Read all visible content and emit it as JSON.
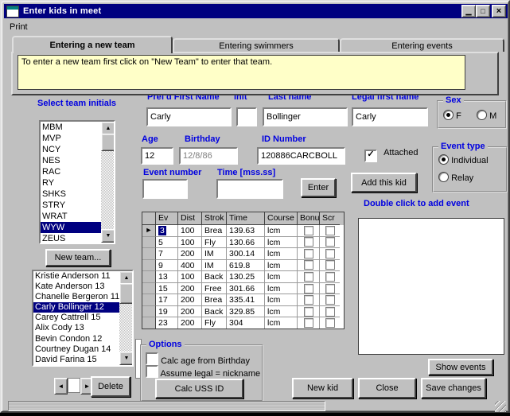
{
  "window": {
    "title": "Enter kids in meet",
    "controls": {
      "minimize": "▁",
      "maximize": "□",
      "close": "×"
    }
  },
  "menu": {
    "print": "Print"
  },
  "tabs": [
    {
      "label": "Entering a new team"
    },
    {
      "label": "Entering swimmers"
    },
    {
      "label": "Entering events"
    }
  ],
  "info_box": "To enter a new team first click on \"New Team\" to enter that team.",
  "team_panel": {
    "label": "Select team initials",
    "teams": [
      "MBM",
      "MVP",
      "NCY",
      "NES",
      "RAC",
      "RY",
      "SHKS",
      "STRY",
      "WRAT",
      "WYW",
      "ZEUS"
    ],
    "selected": "WYW",
    "new_team_button": "New team..."
  },
  "swimmer_panel": {
    "swimmers": [
      "Kristie Anderson 11",
      "Kate Anderson 13",
      "Chanelle Bergeron 11",
      "Carly Bollinger 12",
      "Carey Cattrell 15",
      "Alix Cody 13",
      "Bevin Condon 12",
      "Courtney Dugan 14",
      "David Farina 15"
    ],
    "selected": "Carly Bollinger 12",
    "delete_button": "Delete"
  },
  "form": {
    "prefd_first_name": {
      "label": "Pref'd First Name",
      "value": "Carly"
    },
    "init": {
      "label": "Init",
      "value": ""
    },
    "last_name": {
      "label": "Last name",
      "value": "Bollinger"
    },
    "legal_first_name": {
      "label": "Legal first name",
      "value": "Carly"
    },
    "sex": {
      "label": "Sex",
      "options": [
        "F",
        "M"
      ],
      "selected": "F"
    },
    "age": {
      "label": "Age",
      "value": "12"
    },
    "birthday": {
      "label": "Birthday",
      "value": "12/8/86"
    },
    "id_number": {
      "label": "ID Number",
      "value": "120886CARCBOLL"
    },
    "attached": {
      "label": "Attached",
      "checked": true,
      "check_glyph": "✓"
    },
    "event_type": {
      "label": "Event type",
      "options": [
        "Individual",
        "Relay"
      ],
      "selected": "Individual"
    },
    "event_number": {
      "label": "Event number",
      "value": ""
    },
    "time": {
      "label": "Time [mss.ss]",
      "value": ""
    },
    "enter_button": "Enter",
    "add_this_kid_button": "Add this kid"
  },
  "events_grid": {
    "columns": [
      "Ev",
      "Dist",
      "Strok",
      "Time",
      "Course",
      "Bonu",
      "Scr"
    ],
    "selected_row": 0,
    "row_arrow": "►",
    "rows": [
      [
        "3",
        "100",
        "Brea",
        "139.63",
        "lcm"
      ],
      [
        "5",
        "100",
        "Fly",
        "130.66",
        "lcm"
      ],
      [
        "7",
        "200",
        "IM",
        "300.14",
        "lcm"
      ],
      [
        "9",
        "400",
        "IM",
        "619.8",
        "lcm"
      ],
      [
        "13",
        "100",
        "Back",
        "130.25",
        "lcm"
      ],
      [
        "15",
        "200",
        "Free",
        "301.66",
        "lcm"
      ],
      [
        "17",
        "200",
        "Brea",
        "335.41",
        "lcm"
      ],
      [
        "19",
        "200",
        "Back",
        "329.85",
        "lcm"
      ],
      [
        "23",
        "200",
        "Fly",
        "304",
        "lcm"
      ]
    ]
  },
  "event_list": {
    "hint": "Double click to add event",
    "items": [],
    "show_events_button": "Show events"
  },
  "options": {
    "label": "Options",
    "checkboxes": [
      {
        "label": "Calc age from Birthday",
        "checked": false
      },
      {
        "label": "Assume legal = nickname",
        "checked": false
      }
    ],
    "calc_uss_id_button": "Calc USS ID"
  },
  "footer": {
    "new_kid_button": "New kid",
    "close_button": "Close",
    "save_changes_button": "Save changes"
  },
  "icons": {
    "scroll_up": "▲",
    "scroll_down": "▼",
    "spin_left": "◄",
    "spin_right": "►"
  },
  "colors": {
    "titlebar": "#000080",
    "label_blue": "#0000E0",
    "info_bg": "#FFFFC8",
    "selection_bg": "#000080",
    "window_face": "#C0C0C0"
  }
}
